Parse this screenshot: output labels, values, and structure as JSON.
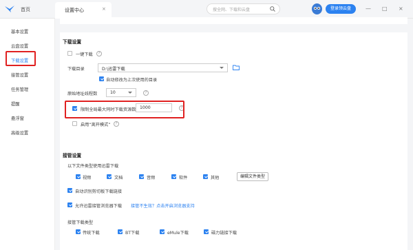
{
  "topbar": {
    "home_label": "首页",
    "tab_title": "设置中心",
    "tab_close": "×",
    "search_placeholder": "搜全网、下载和云盘",
    "login_button": "登录领云盘",
    "win_buttons": [
      "—",
      "□",
      "×"
    ]
  },
  "sidebar": {
    "items": [
      {
        "label": "基本设置"
      },
      {
        "label": "云盘设置"
      },
      {
        "label": "下载设置"
      },
      {
        "label": "接管设置"
      },
      {
        "label": "任务管理"
      },
      {
        "label": "提醒"
      },
      {
        "label": "悬浮窗"
      },
      {
        "label": "高级设置"
      }
    ],
    "active_index": 2
  },
  "download": {
    "title": "下载设置",
    "one_click_label": "一键下载",
    "dir_label": "下载目录",
    "dir_value": "D:\\迅雷下载",
    "auto_modify_label": "自动修改为上次使用的目录",
    "threads_label": "原始地址线程数",
    "threads_value": "10",
    "limit_label": "限制全局最大同时下载资源数",
    "limit_value": "1000",
    "offline_label": "启用“离开模式”"
  },
  "takeover": {
    "title": "接管设置",
    "types_label": "以下文件类型使用迅雷下载",
    "types": [
      {
        "label": "视频"
      },
      {
        "label": "文档"
      },
      {
        "label": "音频"
      },
      {
        "label": "软件"
      },
      {
        "label": "其他"
      }
    ],
    "edit_types_button": "编辑文件类型",
    "clipboard_label": "自动识别剪切板下载链接",
    "browser_label": "允许迅雷接管浏览器下载",
    "browser_link": "接管不生效？点击开启浏览器支持",
    "dl_type_label": "接管下载类型",
    "dl_types": [
      {
        "label": "传统下载"
      },
      {
        "label": "BT下载"
      },
      {
        "label": "eMule下载"
      },
      {
        "label": "磁力链接下载"
      }
    ]
  },
  "colors": {
    "accent": "#2c82f0",
    "highlight_red": "#e02020"
  }
}
